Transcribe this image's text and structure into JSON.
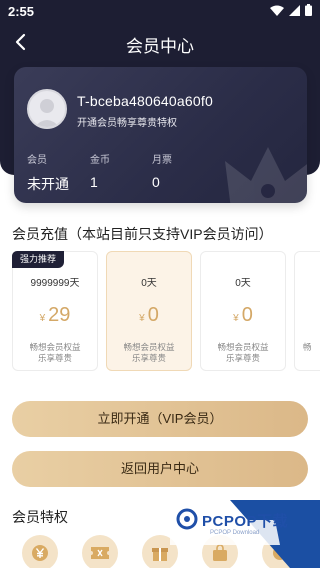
{
  "status_bar": {
    "time": "2:55"
  },
  "nav": {
    "title": "会员中心"
  },
  "card": {
    "user_id": "T-bceba480640a60f0",
    "subtitle": "开通会员畅享尊贵特权",
    "stats": [
      {
        "label": "会员",
        "value": "未开通"
      },
      {
        "label": "金币",
        "value": "1"
      },
      {
        "label": "月票",
        "value": "0"
      }
    ]
  },
  "recharge": {
    "title": "会员充值（本站目前只支持VIP会员访问）",
    "packages": [
      {
        "badge": "强力推荐",
        "days": "9999999天",
        "currency": "¥",
        "price": "29",
        "desc_line1": "畅想会员权益",
        "desc_line2": "乐享尊贵",
        "selected": false
      },
      {
        "badge": "",
        "days": "0天",
        "currency": "¥",
        "price": "0",
        "desc_line1": "畅想会员权益",
        "desc_line2": "乐享尊贵",
        "selected": true
      },
      {
        "badge": "",
        "days": "0天",
        "currency": "¥",
        "price": "0",
        "desc_line1": "畅想会员权益",
        "desc_line2": "乐享尊贵",
        "selected": false
      },
      {
        "badge": "",
        "days": "",
        "currency": "",
        "price": "",
        "desc_line1": "畅",
        "desc_line2": "",
        "selected": false
      }
    ]
  },
  "buttons": {
    "activate": "立即开通（VIP会员）",
    "back_to_user": "返回用户中心"
  },
  "privileges": {
    "title": "会员特权",
    "icons": [
      "yuan-coin-icon",
      "ticket-icon",
      "gift-box-icon",
      "shopping-bag-icon",
      "extra-icon"
    ]
  },
  "watermark": {
    "text": "PCPOP下载",
    "subtext": "PCPOP Download"
  },
  "colors": {
    "hero": "#1d1e33",
    "gold": "#d4a867",
    "button": "#e2c496",
    "badge": "#1f2036"
  }
}
